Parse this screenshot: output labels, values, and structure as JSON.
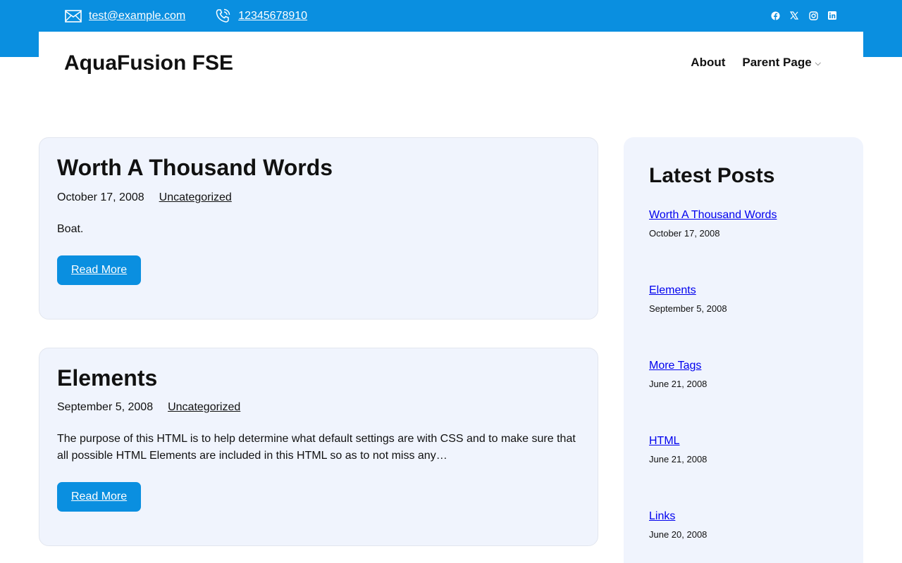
{
  "topbar": {
    "email": "test@example.com",
    "phone": "12345678910",
    "socials": [
      "facebook-icon",
      "x-icon",
      "instagram-icon",
      "linkedin-icon"
    ]
  },
  "header": {
    "site_title": "AquaFusion FSE",
    "nav": {
      "about": "About",
      "parent_page": "Parent Page",
      "chevron": "⌵"
    }
  },
  "posts": [
    {
      "title": "Worth A Thousand Words",
      "date": "October 17, 2008",
      "category": "Uncategorized",
      "excerpt": "Boat.",
      "button": "Read More"
    },
    {
      "title": "Elements",
      "date": "September 5, 2008",
      "category": "Uncategorized",
      "excerpt": "The purpose of this HTML is to help determine what default settings are with CSS and to make sure that all possible HTML Elements are included in this HTML so as to not miss any…",
      "button": "Read More"
    }
  ],
  "sidebar": {
    "title": "Latest Posts",
    "items": [
      {
        "title": "Worth A Thousand Words",
        "date": "October 17, 2008"
      },
      {
        "title": "Elements",
        "date": "September 5, 2008"
      },
      {
        "title": "More Tags",
        "date": "June 21, 2008"
      },
      {
        "title": "HTML",
        "date": "June 21, 2008"
      },
      {
        "title": "Links",
        "date": "June 20, 2008"
      }
    ]
  },
  "colors": {
    "accent": "#0a8fe0",
    "card_bg": "#f0f4fd",
    "link": "#0000ee"
  }
}
